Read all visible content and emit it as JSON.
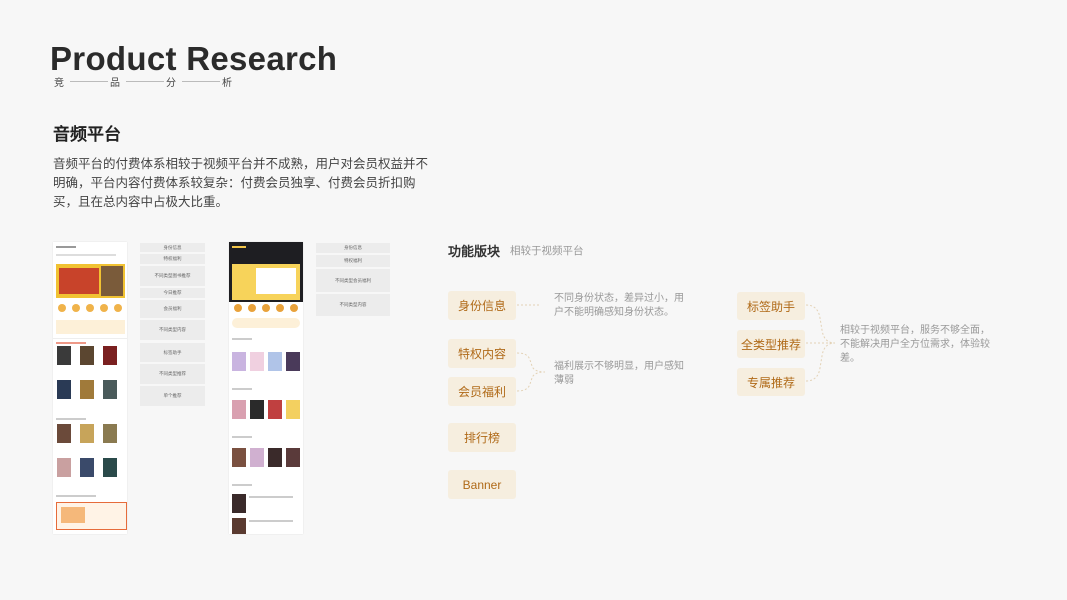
{
  "header": {
    "title": "Product Research",
    "subtitle_chars": [
      "竞",
      "品",
      "分",
      "析"
    ]
  },
  "section": {
    "title": "音频平台",
    "description_lines": [
      "音频平台的付费体系相较于视频平台并不成熟，用户对会员权益并不",
      "明确，平台内容付费体系较复杂：付费会员独享、付费会员折扣购",
      "买，且在总内容中占极大比重。"
    ]
  },
  "phone1": {
    "labels": [
      "身份信息",
      "特权福利",
      "不同类型图书推荐",
      "今日推荐",
      "会员福利",
      "不同类型内容",
      "标签助手",
      "不同类型推荐",
      "单个推荐"
    ]
  },
  "phone2": {
    "labels": [
      "身份信息",
      "特权福利",
      "不同类型会员福利",
      "不同类型内容"
    ]
  },
  "features": {
    "title": "功能版块",
    "subtitle": "相较于视频平台",
    "left_tags": [
      "身份信息",
      "特权内容",
      "会员福利",
      "排行榜",
      "Banner"
    ],
    "right_tags": [
      "标签助手",
      "全类型推荐",
      "专属推荐"
    ],
    "note_identity": [
      "不同身份状态，差异过小，用",
      "户不能明确感知身份状态。"
    ],
    "note_benefit": [
      "福利展示不够明显，用户感知",
      "薄弱"
    ],
    "note_right": [
      "相较于视频平台，服务不够全面，",
      "不能解决用户全方位需求，体验较",
      "差。"
    ]
  },
  "colors": {
    "tag_bg": "#f6eedf",
    "tag_text": "#b06a18",
    "bracket": "#e3d2b6"
  }
}
